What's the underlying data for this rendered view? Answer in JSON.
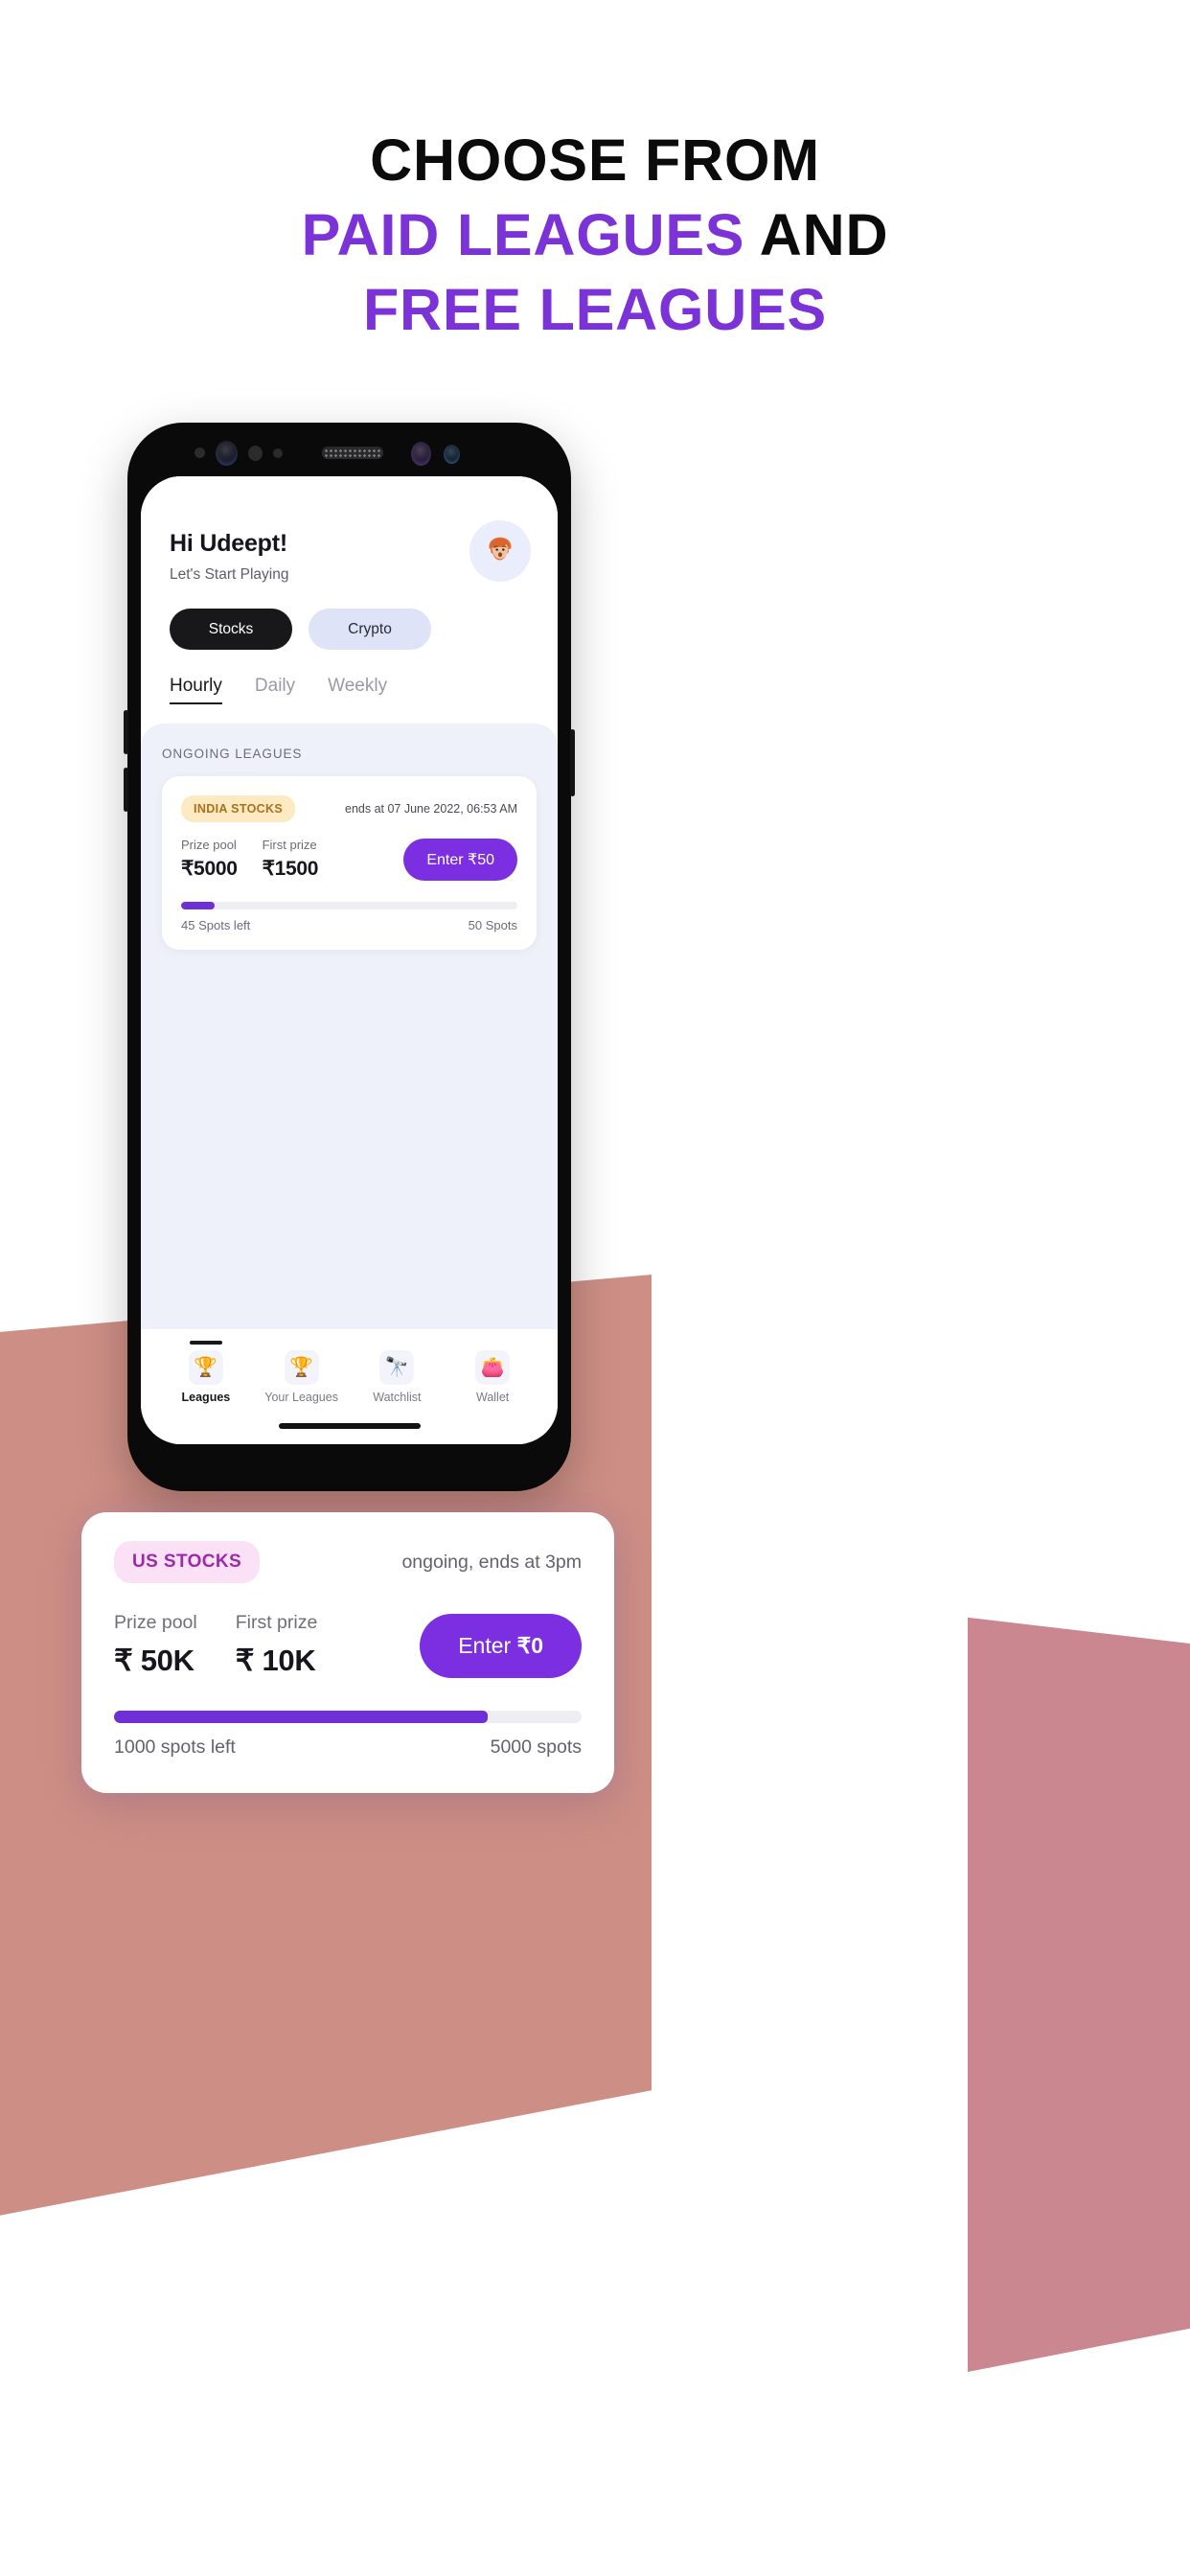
{
  "headline": {
    "line1": "CHOOSE FROM",
    "line2_purple": "PAID LEAGUES",
    "line2_black": " AND",
    "line3": "FREE LEAGUES",
    "accent_color": "#7B32D6",
    "text_color": "#0B0B0B"
  },
  "background": {
    "page_color": "#FFFFFF",
    "shape_left_color": "#CD8F85",
    "shape_right_color": "#CB8790"
  },
  "phone": {
    "frame_color": "#0A0A0A",
    "screen_color": "#FFFFFF",
    "home_indicator_color": "#111114"
  },
  "app": {
    "header": {
      "greeting": "Hi Udeept!",
      "subgreeting": "Let's Start Playing",
      "avatar_name": "user-avatar"
    },
    "market_tabs": [
      {
        "label": "Stocks",
        "selected": true
      },
      {
        "label": "Crypto",
        "selected": false
      }
    ],
    "period_tabs": [
      {
        "label": "Hourly",
        "active": true
      },
      {
        "label": "Daily",
        "active": false
      },
      {
        "label": "Weekly",
        "active": false
      }
    ],
    "ongoing": {
      "section_title": "ONGOING LEAGUES",
      "section_bg": "#EEF0FA",
      "card": {
        "market_chip": "INDIA STOCKS",
        "chip_bg": "#FDE9C2",
        "chip_color": "#A8711A",
        "time_text": "ends at 07 June 2022, 06:53 AM",
        "prize_pool_label": "Prize pool",
        "prize_pool_value": "₹5000",
        "first_prize_label": "First prize",
        "first_prize_value": "₹1500",
        "enter_label": "Enter ₹50",
        "enter_color": "#7B2FE0",
        "progress_percent": 10,
        "spots_left": "45 Spots left",
        "spots_total": "50 Spots"
      }
    },
    "bottom_nav": [
      {
        "label": "Leagues",
        "icon": "trophy-icon",
        "glyph": "🏆",
        "active": true
      },
      {
        "label": "Your Leagues",
        "icon": "trophy-icon",
        "glyph": "🏆",
        "active": false
      },
      {
        "label": "Watchlist",
        "icon": "binoculars-icon",
        "glyph": "🔭",
        "active": false
      },
      {
        "label": "Wallet",
        "icon": "wallet-icon",
        "glyph": "👛",
        "active": false
      }
    ]
  },
  "float_card": {
    "market_chip": "US STOCKS",
    "chip_bg": "#FBE1F6",
    "chip_color": "#9C2AA8",
    "time_text": "ongoing, ends at 3pm",
    "prize_pool_label": "Prize pool",
    "prize_pool_value": "₹ 50K",
    "first_prize_label": "First prize",
    "first_prize_value": "₹ 10K",
    "enter_prefix": "Enter ",
    "enter_amount": "₹0",
    "enter_color": "#7B2FE0",
    "progress_percent": 80,
    "spots_left": "1000 spots left",
    "spots_total": "5000 spots"
  }
}
